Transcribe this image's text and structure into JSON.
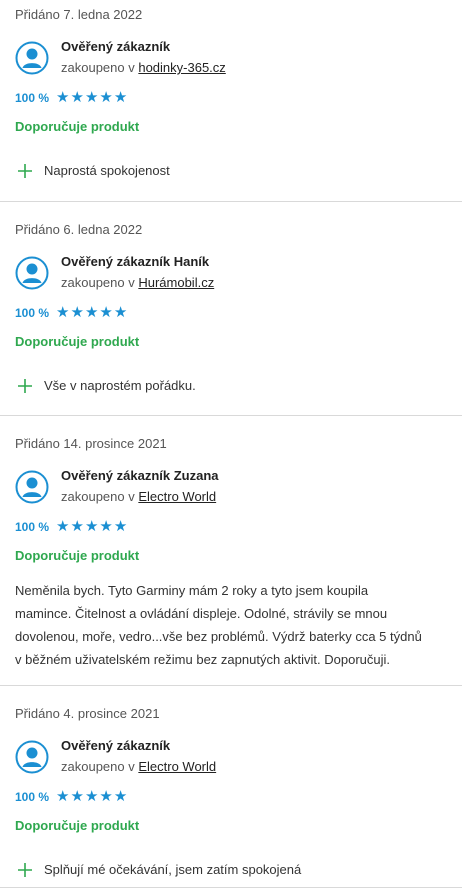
{
  "colors": {
    "accent_blue": "#1b8fd2",
    "recommend_green": "#2fa84f",
    "divider": "#d9d9d9"
  },
  "reviews": [
    {
      "date": "Přidáno 7. ledna 2022",
      "author": "Ověřený zákazník",
      "bought_prefix": "zakoupeno v ",
      "shop": "hodinky-365.cz",
      "percent": "100 %",
      "stars": 5,
      "recommend": "Doporučuje produkt",
      "pro": "Naprostá spokojenost"
    },
    {
      "date": "Přidáno 6. ledna 2022",
      "author": "Ověřený zákazník Haník",
      "bought_prefix": "zakoupeno v ",
      "shop": "Hurámobil.cz",
      "percent": "100 %",
      "stars": 5,
      "recommend": "Doporučuje produkt",
      "pro": "Vše v naprostém pořádku."
    },
    {
      "date": "Přidáno 14. prosince 2021",
      "author": "Ověřený zákazník Zuzana",
      "bought_prefix": "zakoupeno v ",
      "shop": "Electro World",
      "percent": "100 %",
      "stars": 5,
      "recommend": "Doporučuje produkt",
      "text_lines": [
        "Neměnila bych. Tyto Garminy mám 2 roky a tyto jsem koupila",
        "mamince. Čitelnost a ovládání displeje. Odolné, strávily se mnou",
        "dovolenou, moře, vedro...vše bez problémů. Výdrž baterky cca 5 týdnů",
        "v běžném uživatelském režimu bez zapnutých aktivit. Doporučuji."
      ]
    },
    {
      "date": "Přidáno 4. prosince 2021",
      "author": "Ověřený zákazník",
      "bought_prefix": "zakoupeno v ",
      "shop": "Electro World",
      "percent": "100 %",
      "stars": 5,
      "recommend": "Doporučuje produkt",
      "pro": "Splňují mé očekávání, jsem zatím spokojená"
    }
  ],
  "icons": {
    "avatar": "user-avatar-icon",
    "star": "star-icon",
    "plus": "plus-icon"
  }
}
